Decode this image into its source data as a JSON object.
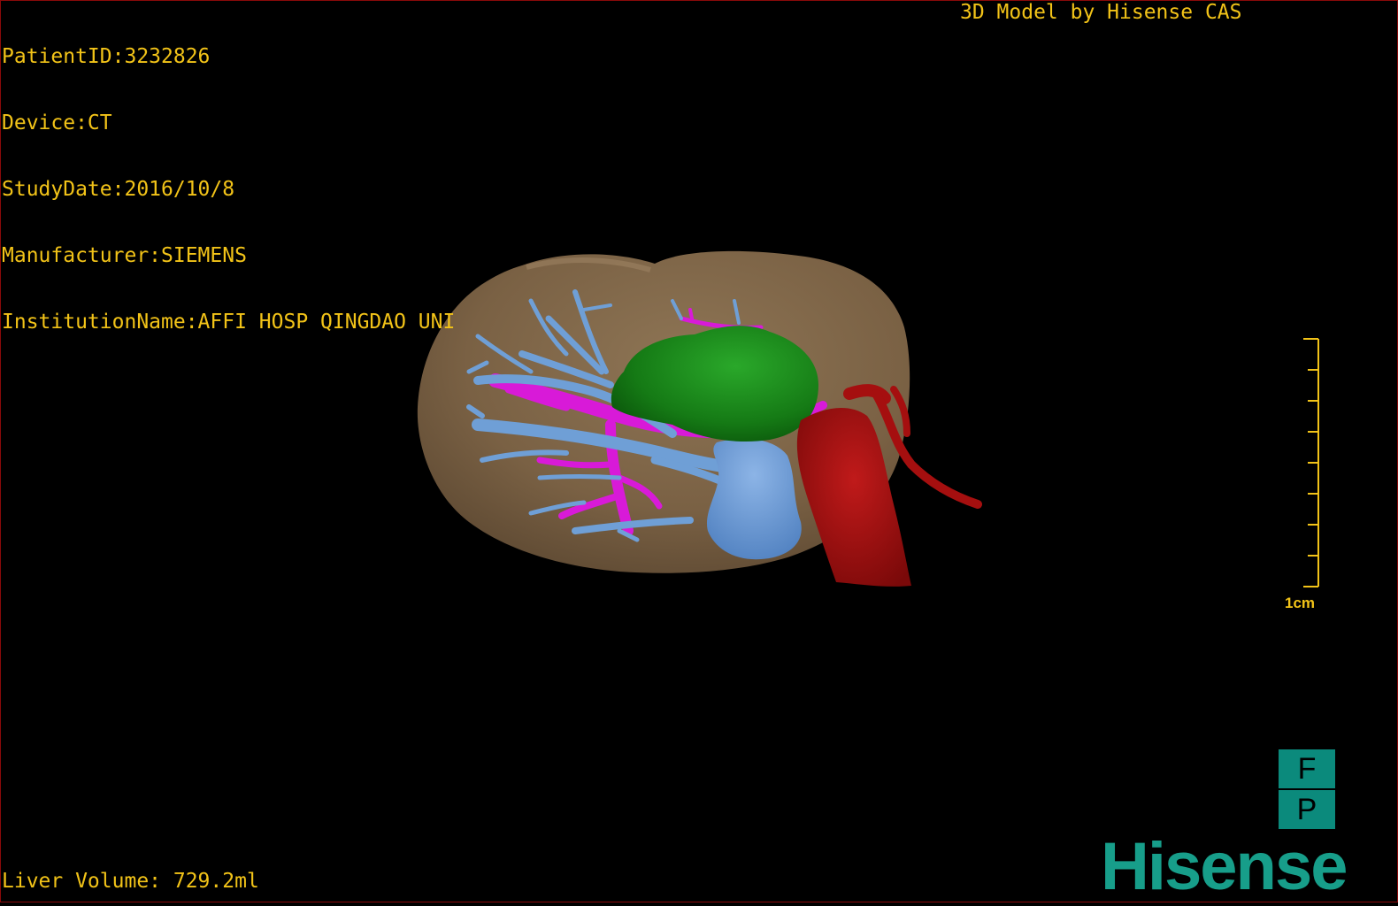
{
  "header": {
    "patient_id": "PatientID:3232826",
    "device": "Device:CT",
    "study_date": "StudyDate:2016/10/8",
    "manufacturer": "Manufacturer:SIEMENS",
    "institution": "InstitutionName:AFFI HOSP QINGDAO UNI",
    "credit": "3D Model by Hisense CAS"
  },
  "footer": {
    "liver_volume": "Liver Volume: 729.2ml",
    "logo": "Hisense"
  },
  "scale": {
    "label": "1cm"
  },
  "orientation": {
    "top": "F",
    "bottom": "P"
  },
  "colors": {
    "text": "#f2c318",
    "liver": "#7f6547",
    "tumor": "#1a8a1a",
    "hepatic_vein": "#6f9fd6",
    "portal_vein": "#d81ad8",
    "artery": "#a50f0f",
    "brand": "#179e8a"
  }
}
